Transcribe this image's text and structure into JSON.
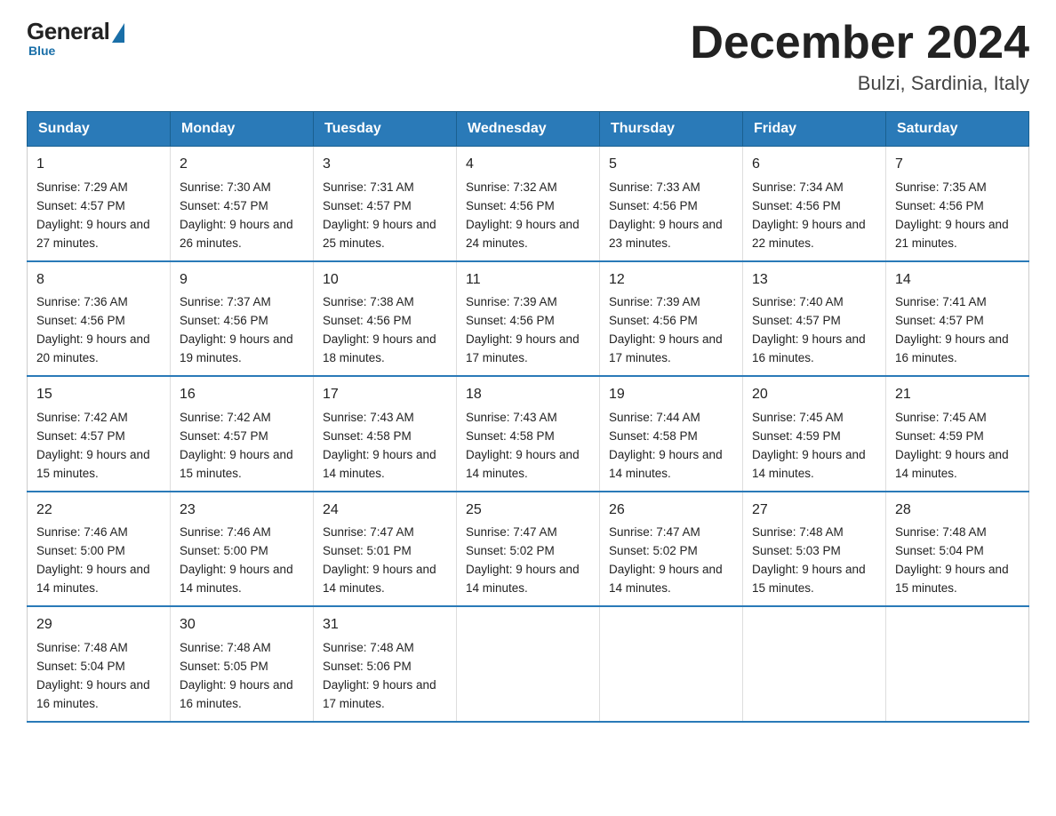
{
  "header": {
    "logo_general": "General",
    "logo_blue": "Blue",
    "month_year": "December 2024",
    "location": "Bulzi, Sardinia, Italy"
  },
  "days_of_week": [
    "Sunday",
    "Monday",
    "Tuesday",
    "Wednesday",
    "Thursday",
    "Friday",
    "Saturday"
  ],
  "weeks": [
    [
      {
        "day": "1",
        "sunrise": "7:29 AM",
        "sunset": "4:57 PM",
        "daylight": "9 hours and 27 minutes."
      },
      {
        "day": "2",
        "sunrise": "7:30 AM",
        "sunset": "4:57 PM",
        "daylight": "9 hours and 26 minutes."
      },
      {
        "day": "3",
        "sunrise": "7:31 AM",
        "sunset": "4:57 PM",
        "daylight": "9 hours and 25 minutes."
      },
      {
        "day": "4",
        "sunrise": "7:32 AM",
        "sunset": "4:56 PM",
        "daylight": "9 hours and 24 minutes."
      },
      {
        "day": "5",
        "sunrise": "7:33 AM",
        "sunset": "4:56 PM",
        "daylight": "9 hours and 23 minutes."
      },
      {
        "day": "6",
        "sunrise": "7:34 AM",
        "sunset": "4:56 PM",
        "daylight": "9 hours and 22 minutes."
      },
      {
        "day": "7",
        "sunrise": "7:35 AM",
        "sunset": "4:56 PM",
        "daylight": "9 hours and 21 minutes."
      }
    ],
    [
      {
        "day": "8",
        "sunrise": "7:36 AM",
        "sunset": "4:56 PM",
        "daylight": "9 hours and 20 minutes."
      },
      {
        "day": "9",
        "sunrise": "7:37 AM",
        "sunset": "4:56 PM",
        "daylight": "9 hours and 19 minutes."
      },
      {
        "day": "10",
        "sunrise": "7:38 AM",
        "sunset": "4:56 PM",
        "daylight": "9 hours and 18 minutes."
      },
      {
        "day": "11",
        "sunrise": "7:39 AM",
        "sunset": "4:56 PM",
        "daylight": "9 hours and 17 minutes."
      },
      {
        "day": "12",
        "sunrise": "7:39 AM",
        "sunset": "4:56 PM",
        "daylight": "9 hours and 17 minutes."
      },
      {
        "day": "13",
        "sunrise": "7:40 AM",
        "sunset": "4:57 PM",
        "daylight": "9 hours and 16 minutes."
      },
      {
        "day": "14",
        "sunrise": "7:41 AM",
        "sunset": "4:57 PM",
        "daylight": "9 hours and 16 minutes."
      }
    ],
    [
      {
        "day": "15",
        "sunrise": "7:42 AM",
        "sunset": "4:57 PM",
        "daylight": "9 hours and 15 minutes."
      },
      {
        "day": "16",
        "sunrise": "7:42 AM",
        "sunset": "4:57 PM",
        "daylight": "9 hours and 15 minutes."
      },
      {
        "day": "17",
        "sunrise": "7:43 AM",
        "sunset": "4:58 PM",
        "daylight": "9 hours and 14 minutes."
      },
      {
        "day": "18",
        "sunrise": "7:43 AM",
        "sunset": "4:58 PM",
        "daylight": "9 hours and 14 minutes."
      },
      {
        "day": "19",
        "sunrise": "7:44 AM",
        "sunset": "4:58 PM",
        "daylight": "9 hours and 14 minutes."
      },
      {
        "day": "20",
        "sunrise": "7:45 AM",
        "sunset": "4:59 PM",
        "daylight": "9 hours and 14 minutes."
      },
      {
        "day": "21",
        "sunrise": "7:45 AM",
        "sunset": "4:59 PM",
        "daylight": "9 hours and 14 minutes."
      }
    ],
    [
      {
        "day": "22",
        "sunrise": "7:46 AM",
        "sunset": "5:00 PM",
        "daylight": "9 hours and 14 minutes."
      },
      {
        "day": "23",
        "sunrise": "7:46 AM",
        "sunset": "5:00 PM",
        "daylight": "9 hours and 14 minutes."
      },
      {
        "day": "24",
        "sunrise": "7:47 AM",
        "sunset": "5:01 PM",
        "daylight": "9 hours and 14 minutes."
      },
      {
        "day": "25",
        "sunrise": "7:47 AM",
        "sunset": "5:02 PM",
        "daylight": "9 hours and 14 minutes."
      },
      {
        "day": "26",
        "sunrise": "7:47 AM",
        "sunset": "5:02 PM",
        "daylight": "9 hours and 14 minutes."
      },
      {
        "day": "27",
        "sunrise": "7:48 AM",
        "sunset": "5:03 PM",
        "daylight": "9 hours and 15 minutes."
      },
      {
        "day": "28",
        "sunrise": "7:48 AM",
        "sunset": "5:04 PM",
        "daylight": "9 hours and 15 minutes."
      }
    ],
    [
      {
        "day": "29",
        "sunrise": "7:48 AM",
        "sunset": "5:04 PM",
        "daylight": "9 hours and 16 minutes."
      },
      {
        "day": "30",
        "sunrise": "7:48 AM",
        "sunset": "5:05 PM",
        "daylight": "9 hours and 16 minutes."
      },
      {
        "day": "31",
        "sunrise": "7:48 AM",
        "sunset": "5:06 PM",
        "daylight": "9 hours and 17 minutes."
      },
      null,
      null,
      null,
      null
    ]
  ],
  "labels": {
    "sunrise": "Sunrise:",
    "sunset": "Sunset:",
    "daylight": "Daylight:"
  }
}
